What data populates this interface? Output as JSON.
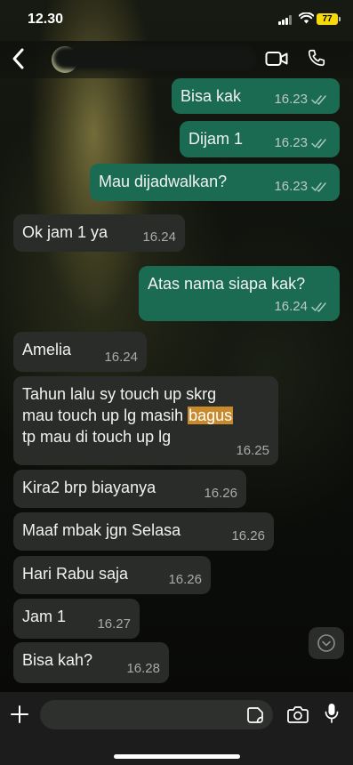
{
  "status_bar": {
    "time": "12.30",
    "battery": "77"
  },
  "header": {
    "back_icon": "chevron-left-icon",
    "video_icon": "video-camera-icon",
    "call_icon": "phone-icon"
  },
  "messages": [
    {
      "direction": "outgoing",
      "text": "Bisa kak",
      "time": "16.23",
      "status": "read"
    },
    {
      "direction": "outgoing",
      "text": "Dijam 1",
      "time": "16.23",
      "status": "read"
    },
    {
      "direction": "outgoing",
      "text": "Mau dijadwalkan?",
      "time": "16.23",
      "status": "read"
    },
    {
      "direction": "incoming",
      "text": "Ok jam 1 ya",
      "time": "16.24"
    },
    {
      "direction": "outgoing",
      "text": "Atas nama siapa kak?",
      "time": "16.24",
      "status": "read"
    },
    {
      "direction": "incoming",
      "text": "Amelia",
      "time": "16.24"
    },
    {
      "direction": "incoming",
      "lines": [
        "Tahun lalu sy touch up skrg",
        "mau touch up lg masih ",
        "tp mau di touch up lg"
      ],
      "highlight": "bagus",
      "time": "16.25"
    },
    {
      "direction": "incoming",
      "text": "Kira2 brp biayanya",
      "time": "16.26"
    },
    {
      "direction": "incoming",
      "text": "Maaf mbak jgn Selasa",
      "time": "16.26"
    },
    {
      "direction": "incoming",
      "text": "Hari Rabu saja",
      "time": "16.26"
    },
    {
      "direction": "incoming",
      "text": "Jam 1",
      "time": "16.27"
    },
    {
      "direction": "incoming",
      "text": "Bisa kah?",
      "time": "16.28"
    }
  ],
  "input_bar": {
    "placeholder": ""
  },
  "colors": {
    "outgoing_bubble": "#1a6b52",
    "incoming_bubble": "#2a2c29",
    "highlight": "#c98a2c"
  }
}
